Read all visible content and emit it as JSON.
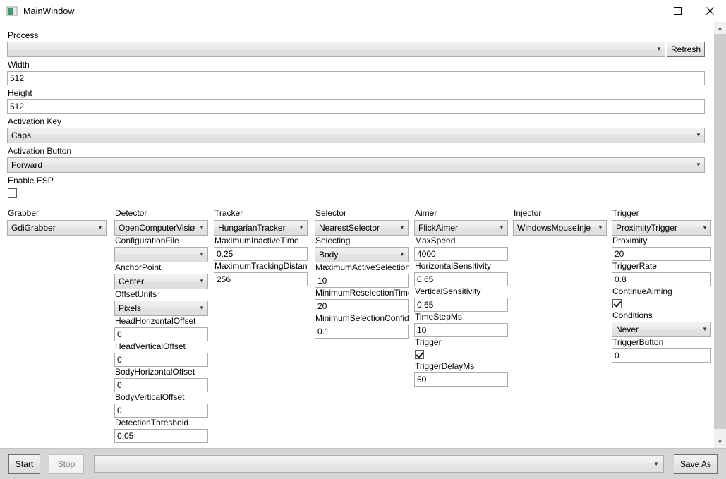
{
  "window": {
    "title": "MainWindow",
    "icon": "window-icon",
    "minimize_icon": "minimize-icon",
    "maximize_icon": "maximize-icon",
    "close_icon": "close-icon"
  },
  "top": {
    "process_label": "Process",
    "process_value": "",
    "refresh_label": "Refresh",
    "width_label": "Width",
    "width_value": "512",
    "height_label": "Height",
    "height_value": "512",
    "activation_key_label": "Activation Key",
    "activation_key_value": "Caps",
    "activation_button_label": "Activation Button",
    "activation_button_value": "Forward",
    "enable_esp_label": "Enable ESP",
    "enable_esp_checked": false
  },
  "columns": {
    "grabber": {
      "header": "Grabber",
      "value": "GdiGrabber"
    },
    "detector": {
      "header": "Detector",
      "value": "OpenComputerVisiø",
      "fields": [
        {
          "label": "ConfigurationFile",
          "value": "",
          "type": "combo"
        },
        {
          "label": "AnchorPoint",
          "value": "Center",
          "type": "combo"
        },
        {
          "label": "OffsetUnits",
          "value": "Pixels",
          "type": "combo"
        },
        {
          "label": "HeadHorizontalOffset",
          "value": "0",
          "type": "text"
        },
        {
          "label": "HeadVerticalOffset",
          "value": "0",
          "type": "text"
        },
        {
          "label": "BodyHorizontalOffset",
          "value": "0",
          "type": "text"
        },
        {
          "label": "BodyVerticalOffset",
          "value": "0",
          "type": "text"
        },
        {
          "label": "DetectionThreshold",
          "value": "0.05",
          "type": "text"
        }
      ]
    },
    "tracker": {
      "header": "Tracker",
      "value": "HungarianTracker",
      "fields": [
        {
          "label": "MaximumInactiveTime",
          "value": "0.25",
          "type": "text"
        },
        {
          "label": "MaximumTrackingDistance",
          "value": "256",
          "type": "text"
        }
      ]
    },
    "selector": {
      "header": "Selector",
      "value": "NearestSelector",
      "fields": [
        {
          "label": "Selecting",
          "value": "Body",
          "type": "combo"
        },
        {
          "label": "MaximumActiveSelections",
          "value": "10",
          "type": "text"
        },
        {
          "label": "MinimumReselectionTime",
          "value": "20",
          "type": "text"
        },
        {
          "label": "MinimumSelectionConfidence",
          "value": "0.1",
          "type": "text"
        }
      ]
    },
    "aimer": {
      "header": "Aimer",
      "value": "FlickAimer",
      "fields": [
        {
          "label": "MaxSpeed",
          "value": "4000",
          "type": "text"
        },
        {
          "label": "HorizontalSensitivity",
          "value": "0.65",
          "type": "text"
        },
        {
          "label": "VerticalSensitivity",
          "value": "0.65",
          "type": "text"
        },
        {
          "label": "TimeStepMs",
          "value": "10",
          "type": "text"
        },
        {
          "label": "Trigger",
          "value": true,
          "type": "check"
        },
        {
          "label": "TriggerDelayMs",
          "value": "50",
          "type": "text"
        }
      ]
    },
    "injector": {
      "header": "Injector",
      "value": "WindowsMouseInje"
    },
    "trigger": {
      "header": "Trigger",
      "value": "ProximityTrigger",
      "fields": [
        {
          "label": "Proximity",
          "value": "20",
          "type": "text"
        },
        {
          "label": "TriggerRate",
          "value": "0.8",
          "type": "text"
        },
        {
          "label": "ContinueAiming",
          "value": true,
          "type": "check"
        },
        {
          "label": "Conditions",
          "value": "Never",
          "type": "combo"
        },
        {
          "label": "TriggerButton",
          "value": "0",
          "type": "text"
        }
      ]
    }
  },
  "bottom": {
    "start_label": "Start",
    "stop_label": "Stop",
    "config_value": "",
    "save_as_label": "Save As"
  },
  "colors": {
    "window_bg": "#ffffff",
    "bottom_bar": "#d5d5d5",
    "field_border": "#abadb3",
    "combo_border": "#acacac",
    "scrollbar_thumb": "#cdcdcd",
    "disabled_text": "#838383"
  }
}
